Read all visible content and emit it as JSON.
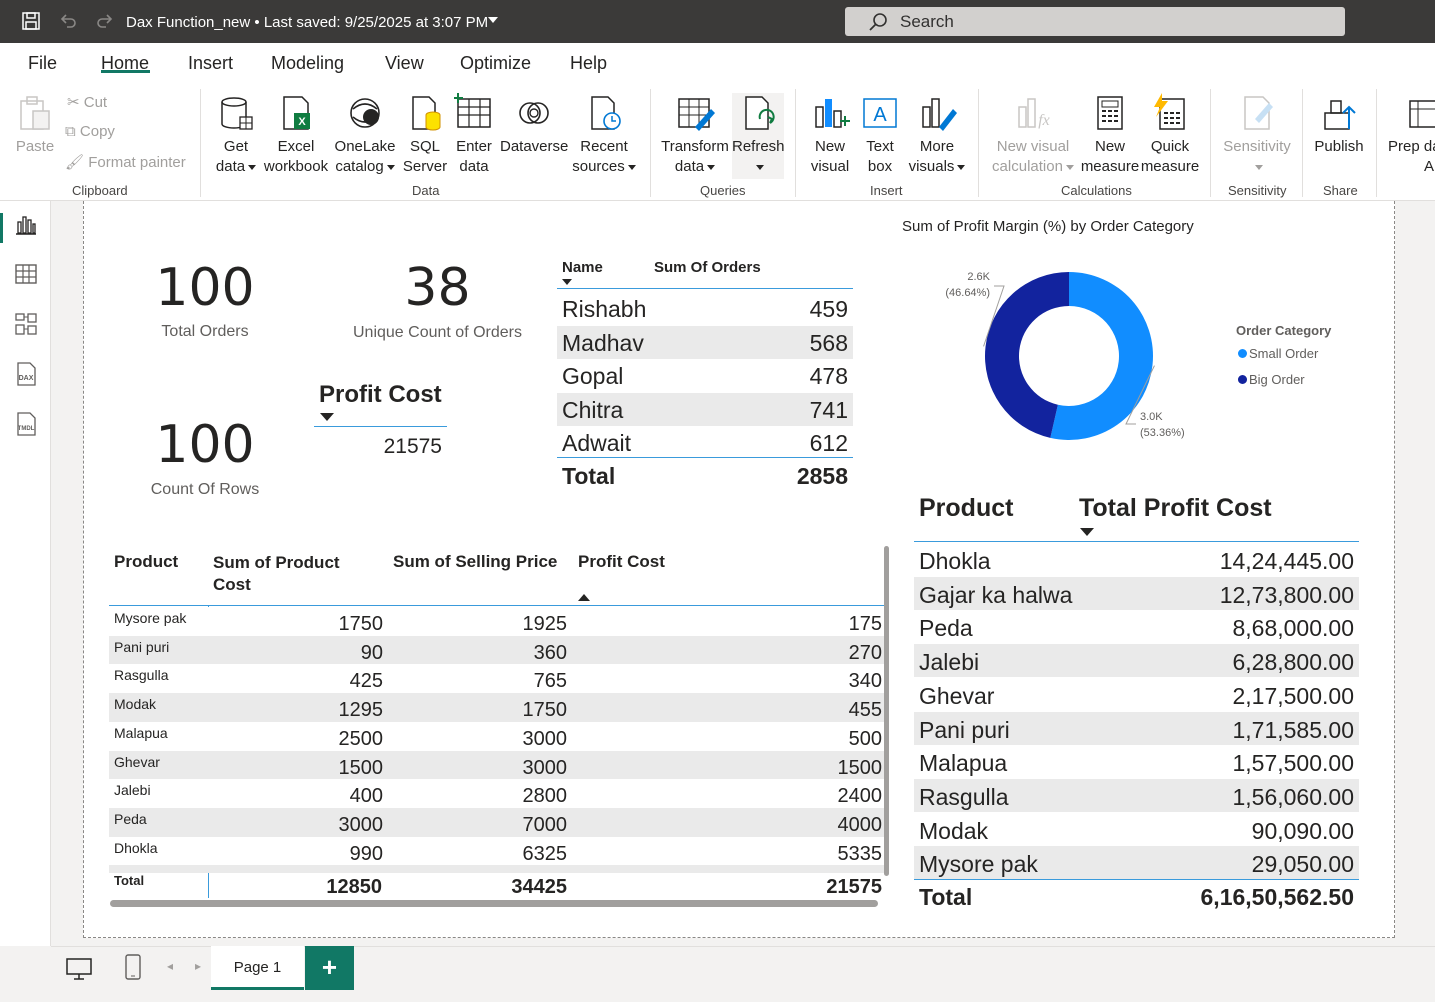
{
  "titlebar": {
    "doc_title": "Dax Function_new",
    "saved_status": "Last saved: 9/25/2025 at 3:07 PM",
    "search_placeholder": "Search"
  },
  "menu": {
    "tabs": [
      "File",
      "Home",
      "Insert",
      "Modeling",
      "View",
      "Optimize",
      "Help"
    ],
    "active": "Home"
  },
  "ribbon": {
    "clipboard": {
      "paste": "Paste",
      "cut": "Cut",
      "copy": "Copy",
      "format_painter": "Format painter",
      "group": "Clipboard"
    },
    "data": {
      "get_data": [
        "Get",
        "data"
      ],
      "excel": [
        "Excel",
        "workbook"
      ],
      "onelake": [
        "OneLake",
        "catalog"
      ],
      "sql": [
        "SQL",
        "Server"
      ],
      "enter": [
        "Enter",
        "data"
      ],
      "dataverse": "Dataverse",
      "recent": [
        "Recent",
        "sources"
      ],
      "group": "Data"
    },
    "queries": {
      "transform": [
        "Transform",
        "data"
      ],
      "refresh": "Refresh",
      "group": "Queries"
    },
    "insert": {
      "new_visual": [
        "New",
        "visual"
      ],
      "text_box": [
        "Text",
        "box"
      ],
      "more_visuals": [
        "More",
        "visuals"
      ],
      "group": "Insert"
    },
    "calculations": {
      "new_visual_calc": [
        "New visual",
        "calculation"
      ],
      "new_measure": [
        "New",
        "measure"
      ],
      "quick_measure": [
        "Quick",
        "measure"
      ],
      "group": "Calculations"
    },
    "sensitivity": {
      "label": "Sensitivity",
      "group": "Sensitivity"
    },
    "share": {
      "publish": "Publish",
      "group": "Share"
    },
    "prep": [
      "Prep da",
      "A"
    ]
  },
  "cards": {
    "total_orders": {
      "value": "100",
      "label": "Total Orders"
    },
    "unique_orders": {
      "value": "38",
      "label": "Unique Count of Orders"
    },
    "count_rows": {
      "value": "100",
      "label": "Count Of Rows"
    },
    "profit_cost": {
      "header": "Profit Cost",
      "value": "21575"
    }
  },
  "orders_table": {
    "headers": [
      "Name",
      "Sum Of Orders"
    ],
    "rows": [
      {
        "name": "Rishabh",
        "value": "459"
      },
      {
        "name": "Madhav",
        "value": "568"
      },
      {
        "name": "Gopal",
        "value": "478"
      },
      {
        "name": "Chitra",
        "value": "741"
      },
      {
        "name": "Adwait",
        "value": "612"
      }
    ],
    "total_label": "Total",
    "total_value": "2858"
  },
  "donut": {
    "title": "Sum of Profit Margin (%) by Order Category",
    "legend_title": "Order Category",
    "colors": {
      "small": "#118dff",
      "big": "#12239e"
    }
  },
  "chart_data": {
    "type": "pie",
    "title": "Sum of Profit Margin (%) by Order Category",
    "legend_title": "Order Category",
    "categories": [
      "Small Order",
      "Big Order"
    ],
    "values": [
      3.0,
      2.6
    ],
    "value_labels": [
      "3.0K",
      "2.6K"
    ],
    "percent_labels": [
      "(53.36%)",
      "(46.64%)"
    ],
    "percents": [
      53.36,
      46.64
    ],
    "legend_placement": "right"
  },
  "product_table": {
    "headers": [
      "Product",
      "Sum of Product Cost",
      "Sum of Selling Price",
      "Profit Cost"
    ],
    "rows": [
      {
        "product": "Mysore pak",
        "cost": "1750",
        "price": "1925",
        "profit": "175"
      },
      {
        "product": "Pani puri",
        "cost": "90",
        "price": "360",
        "profit": "270"
      },
      {
        "product": "Rasgulla",
        "cost": "425",
        "price": "765",
        "profit": "340"
      },
      {
        "product": "Modak",
        "cost": "1295",
        "price": "1750",
        "profit": "455"
      },
      {
        "product": "Malapua",
        "cost": "2500",
        "price": "3000",
        "profit": "500"
      },
      {
        "product": "Ghevar",
        "cost": "1500",
        "price": "3000",
        "profit": "1500"
      },
      {
        "product": "Jalebi",
        "cost": "400",
        "price": "2800",
        "profit": "2400"
      },
      {
        "product": "Peda",
        "cost": "3000",
        "price": "7000",
        "profit": "4000"
      },
      {
        "product": "Dhokla",
        "cost": "990",
        "price": "6325",
        "profit": "5335"
      }
    ],
    "total": {
      "label": "Total",
      "cost": "12850",
      "price": "34425",
      "profit": "21575"
    }
  },
  "total_profit_table": {
    "headers": [
      "Product",
      "Total Profit Cost"
    ],
    "rows": [
      {
        "product": "Dhokla",
        "value": "14,24,445.00"
      },
      {
        "product": "Gajar ka halwa",
        "value": "12,73,800.00"
      },
      {
        "product": "Peda",
        "value": "8,68,000.00"
      },
      {
        "product": "Jalebi",
        "value": "6,28,800.00"
      },
      {
        "product": "Ghevar",
        "value": "2,17,500.00"
      },
      {
        "product": "Pani puri",
        "value": "1,71,585.00"
      },
      {
        "product": "Malapua",
        "value": "1,57,500.00"
      },
      {
        "product": "Rasgulla",
        "value": "1,56,060.00"
      },
      {
        "product": "Modak",
        "value": "90,090.00"
      },
      {
        "product": "Mysore pak",
        "value": "29,050.00"
      }
    ],
    "total_label": "Total",
    "total_value": "6,16,50,562.50"
  },
  "footer": {
    "page_tab": "Page 1",
    "add_page": "+"
  }
}
